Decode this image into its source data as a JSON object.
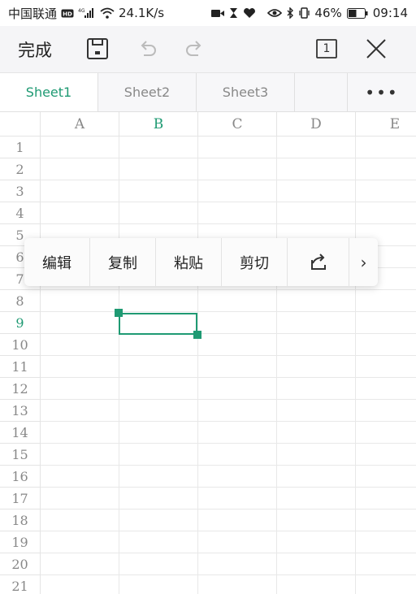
{
  "status_bar": {
    "carrier": "中国联通",
    "speed": "24.1K/s",
    "battery": "46%",
    "time": "09:14"
  },
  "toolbar": {
    "done_label": "完成",
    "sheet_count": "1"
  },
  "tabs": [
    "Sheet1",
    "Sheet2",
    "Sheet3"
  ],
  "tabs_more": "•••",
  "columns": [
    "A",
    "B",
    "C",
    "D",
    "E"
  ],
  "rows": [
    "1",
    "2",
    "3",
    "4",
    "5",
    "6",
    "7",
    "8",
    "9",
    "10",
    "11",
    "12",
    "13",
    "14",
    "15",
    "16",
    "17",
    "18",
    "19",
    "20",
    "21"
  ],
  "active_cell": {
    "column": "B",
    "row": "9"
  },
  "context_menu": {
    "items": [
      "编辑",
      "复制",
      "粘贴",
      "剪切"
    ],
    "more": "›"
  },
  "colors": {
    "accent": "#1f9a73"
  }
}
